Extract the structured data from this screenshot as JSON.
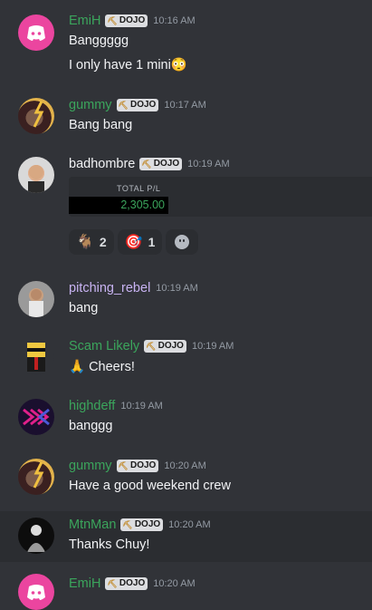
{
  "colors": {
    "green_user": "#3ba55c",
    "white_user": "#f2f3f5",
    "purple_user": "#c8b3f2",
    "positive": "#3ba55c"
  },
  "messages": [
    {
      "username": "EmiH",
      "badge": "DOJO",
      "timestamp": "10:16 AM",
      "lines": [
        "Banggggg",
        "I only have 1 mini😳"
      ],
      "avatar": "discord-logo-icon"
    },
    {
      "username": "gummy",
      "badge": "DOJO",
      "timestamp": "10:17 AM",
      "lines": [
        "Bang bang"
      ],
      "avatar": "user-avatar-gummy"
    },
    {
      "username": "badhombre",
      "badge": "DOJO",
      "timestamp": "10:19 AM",
      "embed": {
        "label": "TOTAL P/L",
        "value": "2,305.00"
      },
      "reactions": [
        {
          "icon": "goat-icon",
          "emoji": "🐐",
          "count": "2"
        },
        {
          "icon": "target-icon",
          "emoji": "🎯",
          "count": "1"
        },
        {
          "icon": "add-reaction-icon"
        }
      ]
    },
    {
      "username": "pitching_rebel",
      "timestamp": "10:19 AM",
      "lines": [
        "bang"
      ]
    },
    {
      "username": "Scam Likely",
      "badge": "DOJO",
      "timestamp": "10:19 AM",
      "lines": [
        "🙏 Cheers!"
      ]
    },
    {
      "username": "highdeff",
      "timestamp": "10:19 AM",
      "lines": [
        "banggg"
      ]
    },
    {
      "username": "gummy",
      "badge": "DOJO",
      "timestamp": "10:20 AM",
      "lines": [
        "Have a good weekend crew"
      ]
    },
    {
      "username": "MtnMan",
      "badge": "DOJO",
      "timestamp": "10:20 AM",
      "lines": [
        "Thanks Chuy!"
      ]
    },
    {
      "username": "EmiH",
      "badge": "DOJO",
      "timestamp": "10:20 AM",
      "lines": [
        ""
      ]
    }
  ]
}
